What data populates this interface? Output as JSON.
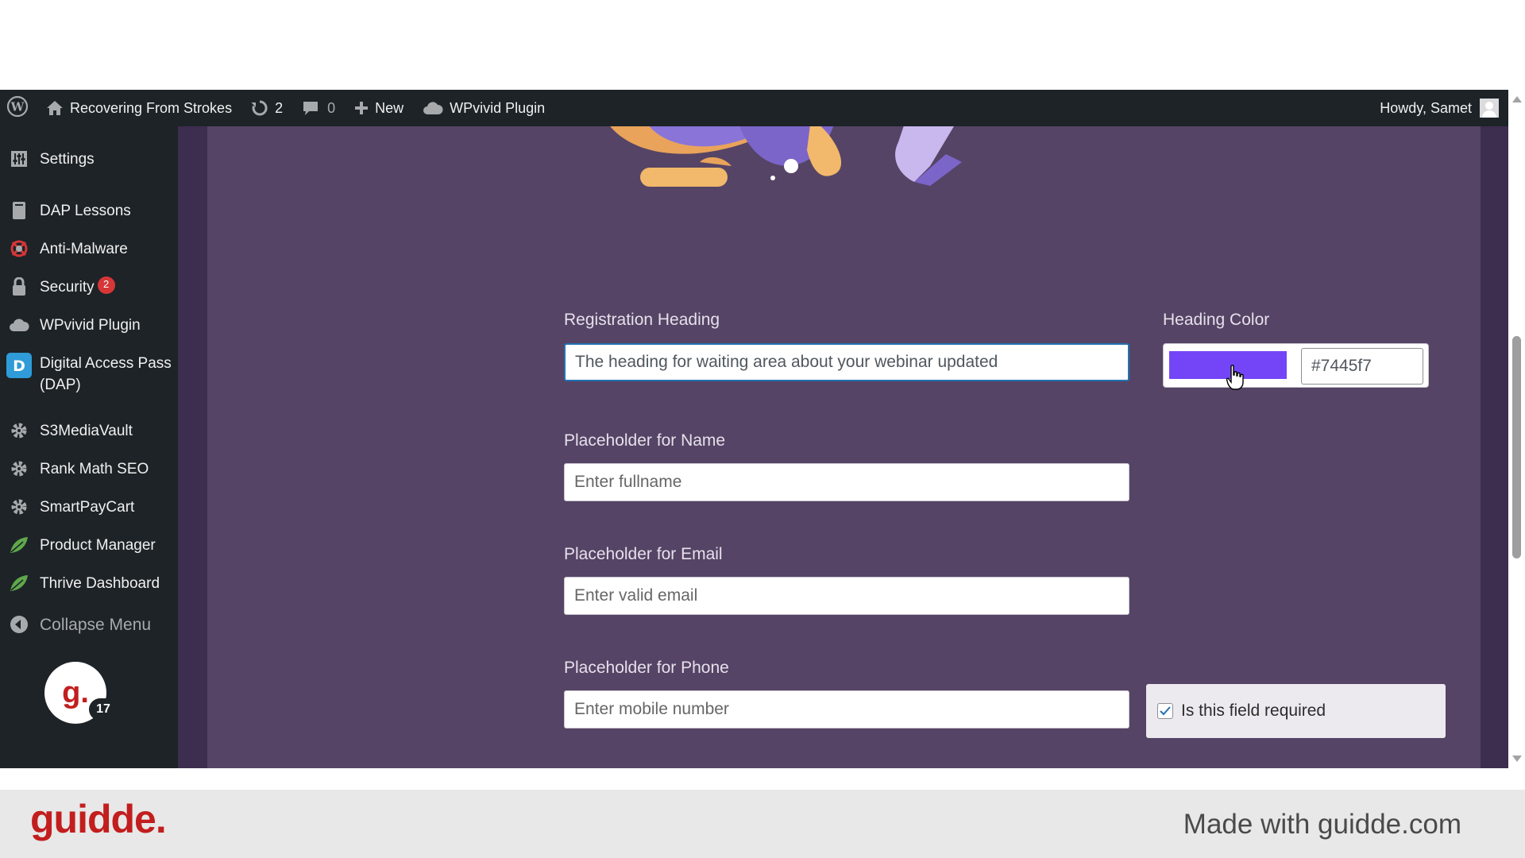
{
  "adminbar": {
    "site_name": "Recovering From Strokes",
    "updates_count": "2",
    "comments_count": "0",
    "new_label": "New",
    "plugin_label": "WPvivid Plugin",
    "greeting": "Howdy, Samet"
  },
  "sidebar": {
    "items": [
      {
        "label": "Settings",
        "icon": "settings-icon"
      },
      {
        "label": "DAP Lessons",
        "icon": "book-icon"
      },
      {
        "label": "Anti-Malware",
        "icon": "malware-icon"
      },
      {
        "label": "Security",
        "icon": "lock-icon",
        "badge": "2"
      },
      {
        "label": "WPvivid Plugin",
        "icon": "cloud-icon"
      },
      {
        "label": "Digital Access Pass (DAP)",
        "icon": "dap-icon",
        "line1": "Digital Access Pass",
        "line2": "(DAP)"
      },
      {
        "label": "S3MediaVault",
        "icon": "gear-icon"
      },
      {
        "label": "Rank Math SEO",
        "icon": "gear-icon"
      },
      {
        "label": "SmartPayCart",
        "icon": "gear-icon"
      },
      {
        "label": "Product Manager",
        "icon": "leaf-icon"
      },
      {
        "label": "Thrive Dashboard",
        "icon": "leaf-icon"
      }
    ],
    "collapse_label": "Collapse Menu",
    "guidde_letter": "g.",
    "guidde_count": "17"
  },
  "form": {
    "registration_heading_label": "Registration Heading",
    "registration_heading_value": "The heading for waiting area about your webinar updated",
    "heading_color_label": "Heading Color",
    "heading_color_value": "#7445f7",
    "name_label": "Placeholder for Name",
    "name_value": "Enter fullname",
    "email_label": "Placeholder for Email",
    "email_value": "Enter valid email",
    "phone_label": "Placeholder for Phone",
    "phone_value": "Enter mobile number",
    "required_label": "Is this field required",
    "required_checked": true
  },
  "footer": {
    "logo": "guidde.",
    "text": "Made with guidde.com"
  },
  "colors": {
    "adminbar_bg": "#1d2327",
    "panel_bg": "#554465",
    "swatch": "#7445f7",
    "brand_red": "#c21e1e"
  }
}
